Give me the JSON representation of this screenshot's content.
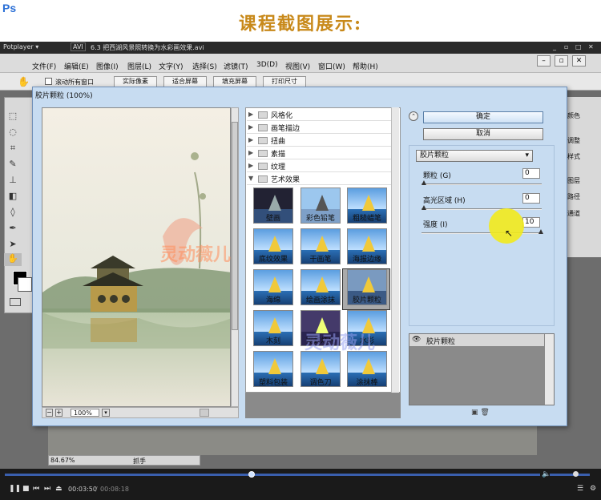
{
  "header": {
    "title": "课程截图展示:"
  },
  "potplayer": {
    "app": "Potplayer ▾",
    "format": "AVI",
    "file": "6.3  把西湖风景照转换为水彩画效果.avi",
    "win_buttons": [
      "_",
      "▫",
      "□",
      "✕"
    ],
    "time_current": "00:03:50",
    "time_total": "00:08:18"
  },
  "photoshop": {
    "logo": "Ps",
    "menu": [
      "文件(F)",
      "编辑(E)",
      "图像(I)",
      "图层(L)",
      "文字(Y)",
      "选择(S)",
      "滤镜(T)",
      "3D(D)",
      "视图(V)",
      "窗口(W)",
      "帮助(H)"
    ],
    "options": {
      "scroll_all": "滚动所有窗口",
      "buttons": [
        "实际像素",
        "适合屏幕",
        "填充屏幕",
        "打印尺寸"
      ]
    },
    "right_panel": [
      "颜色",
      "调整",
      "样式",
      "图层",
      "路径",
      "通道"
    ],
    "status": {
      "zoom": "84.67%",
      "tool": "抓手"
    }
  },
  "dialog": {
    "title": "胶片颗粒 (100%)",
    "zoom": "100%",
    "categories": [
      "风格化",
      "画笔描边",
      "扭曲",
      "素描",
      "纹理",
      "艺术效果"
    ],
    "filters": [
      "壁画",
      "彩色铅笔",
      "粗糙蜡笔",
      "底纹效果",
      "干画笔",
      "海报边缘",
      "海绵",
      "绘画涂抹",
      "胶片颗粒",
      "木刻",
      "霓虹灯光",
      "水彩",
      "塑料包装",
      "调色刀",
      "涂抹棒"
    ],
    "ok": "确定",
    "cancel": "取消",
    "selected_filter": "胶片颗粒",
    "params": [
      {
        "label": "颗粒 (G)",
        "value": "0"
      },
      {
        "label": "高光区域 (H)",
        "value": "0"
      },
      {
        "label": "强度 (I)",
        "value": "10"
      }
    ],
    "layer": "胶片颗粒"
  },
  "watermark": "灵动薇儿"
}
